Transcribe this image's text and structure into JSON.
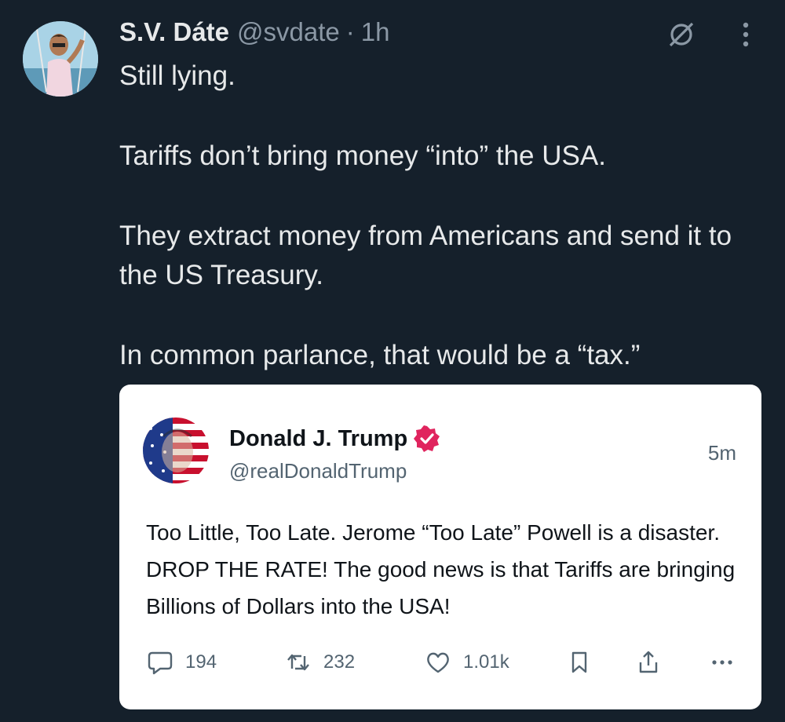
{
  "tweet": {
    "author_name": "S.V. Dáte",
    "author_handle": "@svdate",
    "separator": "·",
    "time": "1h",
    "paragraphs": [
      "Still lying.",
      "Tariffs don’t bring money “into” the USA.",
      "They extract money from Americans and send it to the US Treasury.",
      "In common parlance, that would be a “tax.”"
    ]
  },
  "quoted": {
    "author_name": "Donald J. Trump",
    "author_handle": "@realDonaldTrump",
    "time": "5m",
    "text": "Too Little, Too Late. Jerome “Too Late” Powell is a disaster. DROP THE RATE! The good news is that Tariffs are bringing Billions of Dollars into the USA!",
    "replies": "194",
    "reposts": "232",
    "likes": "1.01k"
  },
  "colors": {
    "background": "#15202b",
    "verified_badge": "#e0245e"
  },
  "icons": [
    "grok-icon",
    "more-icon",
    "reply-icon",
    "repost-icon",
    "like-icon",
    "bookmark-icon",
    "share-icon",
    "more-horizontal-icon",
    "verified-badge-icon"
  ]
}
